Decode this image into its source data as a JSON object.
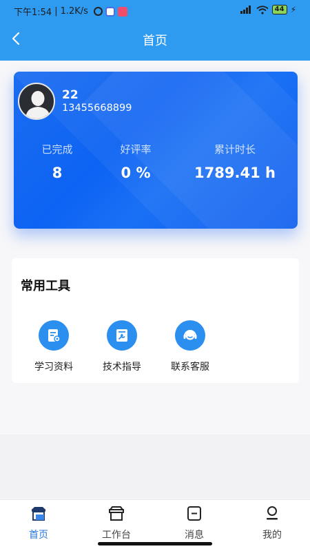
{
  "status_bar": {
    "time": "下午1:54",
    "network_speed": "1.2K/s",
    "battery": "44",
    "icons": [
      "alarm-icon",
      "app-notification-icon",
      "video-app-icon",
      "hd-signal-icon",
      "wifi-icon",
      "charging-icon"
    ]
  },
  "header": {
    "title": "首页"
  },
  "profile": {
    "name": "22",
    "phone": "13455668899",
    "stats": [
      {
        "label": "已完成",
        "value": "8"
      },
      {
        "label": "好评率",
        "value": "0 %"
      },
      {
        "label": "累计时长",
        "value": "1789.41 h"
      }
    ]
  },
  "tools": {
    "title": "常用工具",
    "items": [
      {
        "label": "学习资料",
        "icon": "study-materials-icon"
      },
      {
        "label": "技术指导",
        "icon": "tech-guide-icon"
      },
      {
        "label": "联系客服",
        "icon": "customer-service-icon"
      }
    ]
  },
  "bottom_nav": {
    "items": [
      {
        "label": "首页",
        "icon": "home-icon",
        "active": true
      },
      {
        "label": "工作台",
        "icon": "workbench-icon",
        "active": false
      },
      {
        "label": "消息",
        "icon": "message-icon",
        "active": false
      },
      {
        "label": "我的",
        "icon": "profile-icon",
        "active": false
      }
    ]
  },
  "colors": {
    "header": "#2e9bf0",
    "card": "#0d63f3",
    "accent": "#2b8ff0",
    "active_nav": "#2776d8"
  }
}
